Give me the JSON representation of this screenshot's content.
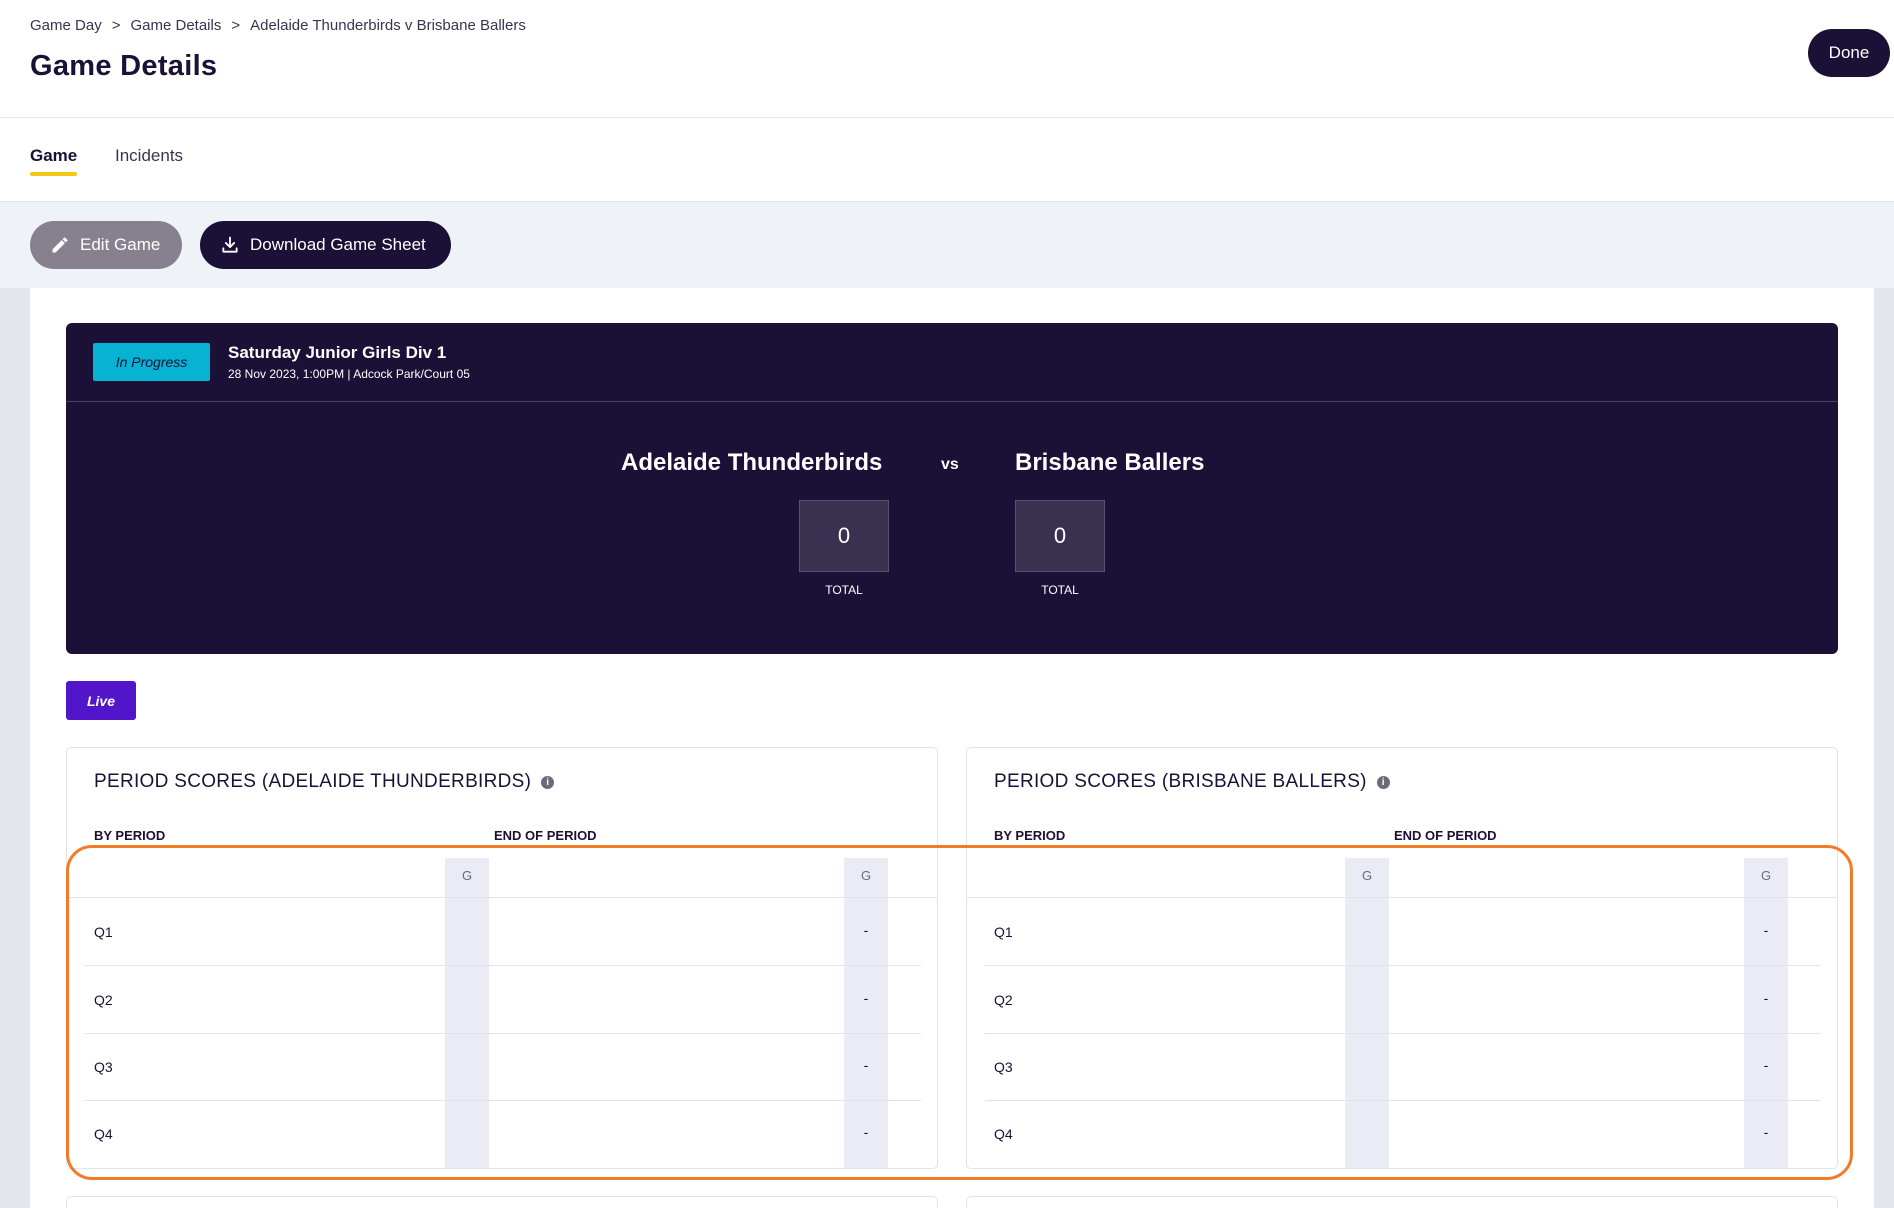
{
  "breadcrumb": [
    "Game Day",
    "Game Details",
    "Adelaide Thunderbirds v Brisbane Ballers"
  ],
  "breadcrumb_separator": ">",
  "page_title": "Game Details",
  "done_label": "Done",
  "tabs": [
    {
      "label": "Game",
      "active": true
    },
    {
      "label": "Incidents",
      "active": false
    }
  ],
  "actions": {
    "edit_label": "Edit Game",
    "edit_icon": "pencil-icon",
    "download_label": "Download Game Sheet",
    "download_icon": "download-icon"
  },
  "game": {
    "status": "In Progress",
    "competition": "Saturday Junior Girls Div 1",
    "meta": "28 Nov 2023, 1:00PM | Adcock Park/Court 05",
    "home_team": "Adelaide Thunderbirds",
    "away_team": "Brisbane Ballers",
    "vs_label": "vs",
    "home_score": "0",
    "away_score": "0",
    "total_label": "TOTAL"
  },
  "live_label": "Live",
  "period_panels": [
    {
      "title": "PERIOD SCORES (ADELAIDE THUNDERBIRDS)",
      "by_period_label": "BY PERIOD",
      "end_of_period_label": "END OF PERIOD",
      "col_header": "G",
      "rows": [
        {
          "label": "Q1",
          "by_period": "",
          "end_of_period": "-"
        },
        {
          "label": "Q2",
          "by_period": "",
          "end_of_period": "-"
        },
        {
          "label": "Q3",
          "by_period": "",
          "end_of_period": "-"
        },
        {
          "label": "Q4",
          "by_period": "",
          "end_of_period": "-"
        }
      ]
    },
    {
      "title": "PERIOD SCORES (BRISBANE BALLERS)",
      "by_period_label": "BY PERIOD",
      "end_of_period_label": "END OF PERIOD",
      "col_header": "G",
      "rows": [
        {
          "label": "Q1",
          "by_period": "",
          "end_of_period": "-"
        },
        {
          "label": "Q2",
          "by_period": "",
          "end_of_period": "-"
        },
        {
          "label": "Q3",
          "by_period": "",
          "end_of_period": "-"
        },
        {
          "label": "Q4",
          "by_period": "",
          "end_of_period": "-"
        }
      ]
    }
  ],
  "colors": {
    "navy": "#1b1036",
    "status_cyan": "#07b3d2",
    "live_purple": "#5215c9",
    "tab_underline": "#f5c518",
    "highlight_orange": "#f07c2a"
  }
}
